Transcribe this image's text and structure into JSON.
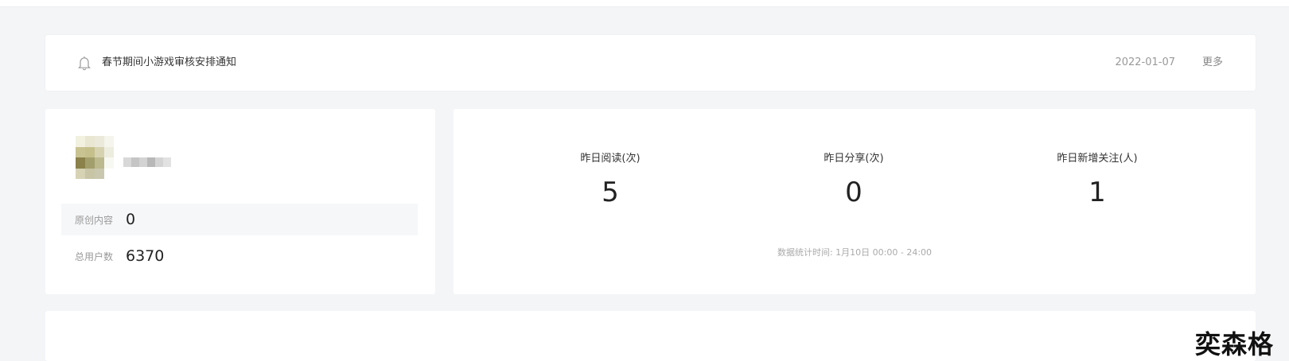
{
  "notice": {
    "bell_icon": "bell-icon",
    "title": "春节期间小游戏审核安排通知",
    "date": "2022-01-07",
    "more_label": "更多"
  },
  "account": {
    "avatar_icon": "pixelated-avatar",
    "name": "",
    "stats": [
      {
        "label": "原创内容",
        "value": "0"
      },
      {
        "label": "总用户数",
        "value": "6370"
      }
    ]
  },
  "daily": {
    "metrics": [
      {
        "label": "昨日阅读(次)",
        "value": "5"
      },
      {
        "label": "昨日分享(次)",
        "value": "0"
      },
      {
        "label": "昨日新增关注(人)",
        "value": "1"
      }
    ],
    "footnote": "数据统计时间: 1月10日 00:00 - 24:00"
  },
  "watermark": "奕森格",
  "colors": {
    "page_bg": "#f4f5f7",
    "card_bg": "#ffffff",
    "muted_text": "#999999",
    "primary_text": "#333333"
  }
}
